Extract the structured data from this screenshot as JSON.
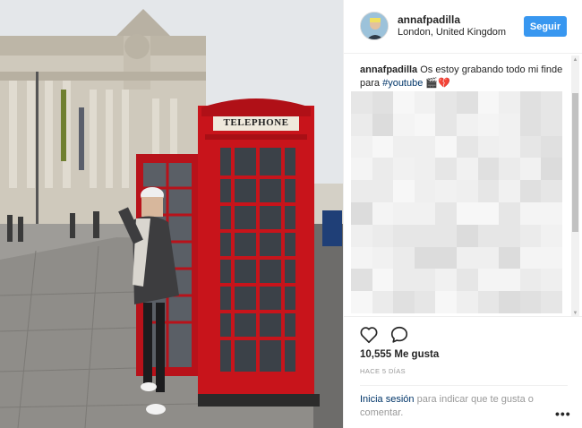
{
  "post": {
    "username": "annafpadilla",
    "location": "London, United Kingdom",
    "follow_label": "Seguir",
    "caption": {
      "username": "annafpadilla",
      "text_before": "Os estoy grabando todo mi finde para ",
      "hashtag": "#youtube",
      "text_after": " 🎬💔"
    },
    "photo": {
      "booth_sign": "TELEPHONE"
    },
    "likes": "10,555 Me gusta",
    "timestamp": "HACE 5 DÍAS",
    "login_prompt": {
      "link": "Inicia sesión",
      "text": " para indicar que te gusta o comentar."
    },
    "more_options": "•••"
  },
  "icons": {
    "like": "heart-icon",
    "comment": "comment-icon",
    "more": "more-options-icon",
    "scroll_up": "scroll-up-arrow",
    "scroll_down": "scroll-down-arrow"
  },
  "colors": {
    "follow_button": "#3897f0",
    "link": "#003569",
    "muted_text": "#999999",
    "phone_booth_red": "#c8141b"
  }
}
